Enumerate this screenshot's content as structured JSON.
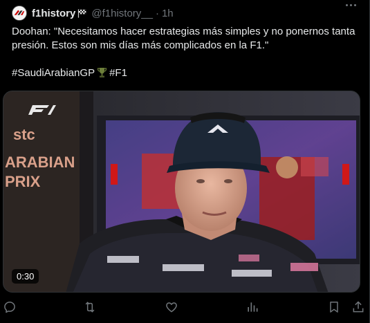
{
  "post": {
    "author": {
      "display_name": "f1history",
      "handle": "@f1history__",
      "avatar_icon": "f1history-logo",
      "badge_icon": "checkered-flag-icon"
    },
    "separator": "·",
    "time": "1h",
    "text_line": "Doohan: \"Necesitamos hacer estrategias más simples y no ponernos tanta presión. Estos son mis días más complicados en la F1.\"",
    "hashtag_1": "#SaudiArabianGP",
    "hashtag_2": "#F1",
    "hashtag_emoji_icon": "trophy-icon",
    "video": {
      "duration": "0:30",
      "overlay_logo": "F1",
      "sponsor_text": "stc",
      "backdrop_text_1": "ARABIAN",
      "backdrop_text_2": "PRIX",
      "cap_brand": "alpine-logo",
      "shirt_brands": [
        "BWT",
        "BINANCE",
        "ALPINE",
        "BWT",
        "LIZE"
      ]
    }
  },
  "actions": [
    {
      "name": "reply",
      "icon": "reply-icon"
    },
    {
      "name": "repost",
      "icon": "repost-icon"
    },
    {
      "name": "like",
      "icon": "heart-icon"
    },
    {
      "name": "views",
      "icon": "analytics-icon"
    },
    {
      "name": "bookmark",
      "icon": "bookmark-icon"
    },
    {
      "name": "share",
      "icon": "share-icon"
    }
  ],
  "colors": {
    "background": "#000000",
    "text": "#e7e9ea",
    "muted": "#71767b",
    "border": "#2f3336"
  }
}
